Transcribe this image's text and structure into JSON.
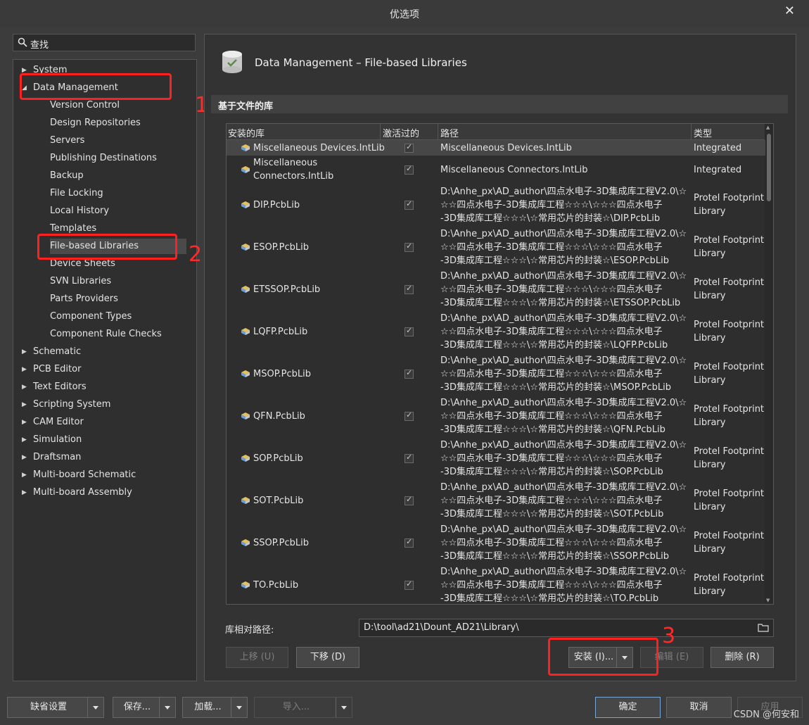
{
  "window": {
    "title": "优选项",
    "close_glyph": "✕"
  },
  "search": {
    "text": "查找",
    "icon": "search-icon"
  },
  "tree": {
    "items": [
      {
        "label": "System",
        "level": 0,
        "expanded": false,
        "selected": false
      },
      {
        "label": "Data Management",
        "level": 0,
        "expanded": true,
        "selected": false
      },
      {
        "label": "Version Control",
        "level": 1,
        "selected": false
      },
      {
        "label": "Design Repositories",
        "level": 1,
        "selected": false
      },
      {
        "label": "Servers",
        "level": 1,
        "selected": false
      },
      {
        "label": "Publishing Destinations",
        "level": 1,
        "selected": false
      },
      {
        "label": "Backup",
        "level": 1,
        "selected": false
      },
      {
        "label": "File Locking",
        "level": 1,
        "selected": false
      },
      {
        "label": "Local History",
        "level": 1,
        "selected": false
      },
      {
        "label": "Templates",
        "level": 1,
        "selected": false
      },
      {
        "label": "File-based Libraries",
        "level": 1,
        "selected": true
      },
      {
        "label": "Device Sheets",
        "level": 1,
        "selected": false
      },
      {
        "label": "SVN Libraries",
        "level": 1,
        "selected": false
      },
      {
        "label": "Parts Providers",
        "level": 1,
        "selected": false
      },
      {
        "label": "Component Types",
        "level": 1,
        "selected": false
      },
      {
        "label": "Component Rule Checks",
        "level": 1,
        "selected": false
      },
      {
        "label": "Schematic",
        "level": 0,
        "expanded": false,
        "selected": false
      },
      {
        "label": "PCB Editor",
        "level": 0,
        "expanded": false,
        "selected": false
      },
      {
        "label": "Text Editors",
        "level": 0,
        "expanded": false,
        "selected": false
      },
      {
        "label": "Scripting System",
        "level": 0,
        "expanded": false,
        "selected": false
      },
      {
        "label": "CAM Editor",
        "level": 0,
        "expanded": false,
        "selected": false
      },
      {
        "label": "Simulation",
        "level": 0,
        "expanded": false,
        "selected": false
      },
      {
        "label": "Draftsman",
        "level": 0,
        "expanded": false,
        "selected": false
      },
      {
        "label": "Multi-board Schematic",
        "level": 0,
        "expanded": false,
        "selected": false
      },
      {
        "label": "Multi-board Assembly",
        "level": 0,
        "expanded": false,
        "selected": false
      }
    ]
  },
  "annotations": {
    "one": "1",
    "two": "2",
    "three": "3",
    "color": "#ff2020"
  },
  "page": {
    "heading": "Data Management – File-based Libraries",
    "section": "基于文件的库",
    "columns": {
      "installed": "安装的库",
      "active": "激活过的",
      "path": "路径",
      "type": "类型"
    },
    "rows": [
      {
        "name": "Miscellaneous Devices.IntLib",
        "active": true,
        "path": "Miscellaneous Devices.IntLib",
        "type": "Integrated",
        "selected": true
      },
      {
        "name": "Miscellaneous\nConnectors.IntLib",
        "active": true,
        "path": "Miscellaneous Connectors.IntLib",
        "type": "Integrated",
        "selected": false
      },
      {
        "name": "DIP.PcbLib",
        "active": true,
        "path": "D:\\Anhe_px\\AD_author\\四点水电子-3D集成库工程V2.0\\☆\n☆☆四点水电子-3D集成库工程☆☆☆\\☆☆☆四点水电子\n-3D集成库工程☆☆☆\\☆常用芯片的封装☆\\DIP.PcbLib",
        "type": "Protel Footprint\nLibrary",
        "selected": false
      },
      {
        "name": "ESOP.PcbLib",
        "active": true,
        "path": "D:\\Anhe_px\\AD_author\\四点水电子-3D集成库工程V2.0\\☆\n☆☆四点水电子-3D集成库工程☆☆☆\\☆☆☆四点水电子\n-3D集成库工程☆☆☆\\☆常用芯片的封装☆\\ESOP.PcbLib",
        "type": "Protel Footprint\nLibrary",
        "selected": false
      },
      {
        "name": "ETSSOP.PcbLib",
        "active": true,
        "path": "D:\\Anhe_px\\AD_author\\四点水电子-3D集成库工程V2.0\\☆\n☆☆四点水电子-3D集成库工程☆☆☆\\☆☆☆四点水电子\n-3D集成库工程☆☆☆\\☆常用芯片的封装☆\\ETSSOP.PcbLib",
        "type": "Protel Footprint\nLibrary",
        "selected": false
      },
      {
        "name": "LQFP.PcbLib",
        "active": true,
        "path": "D:\\Anhe_px\\AD_author\\四点水电子-3D集成库工程V2.0\\☆\n☆☆四点水电子-3D集成库工程☆☆☆\\☆☆☆四点水电子\n-3D集成库工程☆☆☆\\☆常用芯片的封装☆\\LQFP.PcbLib",
        "type": "Protel Footprint\nLibrary",
        "selected": false
      },
      {
        "name": "MSOP.PcbLib",
        "active": true,
        "path": "D:\\Anhe_px\\AD_author\\四点水电子-3D集成库工程V2.0\\☆\n☆☆四点水电子-3D集成库工程☆☆☆\\☆☆☆四点水电子\n-3D集成库工程☆☆☆\\☆常用芯片的封装☆\\MSOP.PcbLib",
        "type": "Protel Footprint\nLibrary",
        "selected": false
      },
      {
        "name": "QFN.PcbLib",
        "active": true,
        "path": "D:\\Anhe_px\\AD_author\\四点水电子-3D集成库工程V2.0\\☆\n☆☆四点水电子-3D集成库工程☆☆☆\\☆☆☆四点水电子\n-3D集成库工程☆☆☆\\☆常用芯片的封装☆\\QFN.PcbLib",
        "type": "Protel Footprint\nLibrary",
        "selected": false
      },
      {
        "name": "SOP.PcbLib",
        "active": true,
        "path": "D:\\Anhe_px\\AD_author\\四点水电子-3D集成库工程V2.0\\☆\n☆☆四点水电子-3D集成库工程☆☆☆\\☆☆☆四点水电子\n-3D集成库工程☆☆☆\\☆常用芯片的封装☆\\SOP.PcbLib",
        "type": "Protel Footprint\nLibrary",
        "selected": false
      },
      {
        "name": "SOT.PcbLib",
        "active": true,
        "path": "D:\\Anhe_px\\AD_author\\四点水电子-3D集成库工程V2.0\\☆\n☆☆四点水电子-3D集成库工程☆☆☆\\☆☆☆四点水电子\n-3D集成库工程☆☆☆\\☆常用芯片的封装☆\\SOT.PcbLib",
        "type": "Protel Footprint\nLibrary",
        "selected": false
      },
      {
        "name": "SSOP.PcbLib",
        "active": true,
        "path": "D:\\Anhe_px\\AD_author\\四点水电子-3D集成库工程V2.0\\☆\n☆☆四点水电子-3D集成库工程☆☆☆\\☆☆☆四点水电子\n-3D集成库工程☆☆☆\\☆常用芯片的封装☆\\SSOP.PcbLib",
        "type": "Protel Footprint\nLibrary",
        "selected": false
      },
      {
        "name": "TO.PcbLib",
        "active": true,
        "path": "D:\\Anhe_px\\AD_author\\四点水电子-3D集成库工程V2.0\\☆\n☆☆四点水电子-3D集成库工程☆☆☆\\☆☆☆四点水电子\n-3D集成库工程☆☆☆\\☆常用芯片的封装☆\\TO.PcbLib",
        "type": "Protel Footprint\nLibrary",
        "selected": false
      }
    ],
    "relative_path_label": "库相对路径:",
    "relative_path_value": "D:\\tool\\ad21\\Dount_AD21\\Library\\",
    "buttons": {
      "move_up": "上移 (U)",
      "move_down": "下移 (D)",
      "install": "安装 (I)...",
      "edit": "编辑 (E)",
      "remove": "删除 (R)"
    }
  },
  "footer": {
    "defaults": "缺省设置",
    "save": "保存...",
    "load": "加载...",
    "import": "导入...",
    "ok": "确定",
    "cancel": "取消",
    "apply": "应用",
    "watermark": "CSDN @何安和"
  }
}
